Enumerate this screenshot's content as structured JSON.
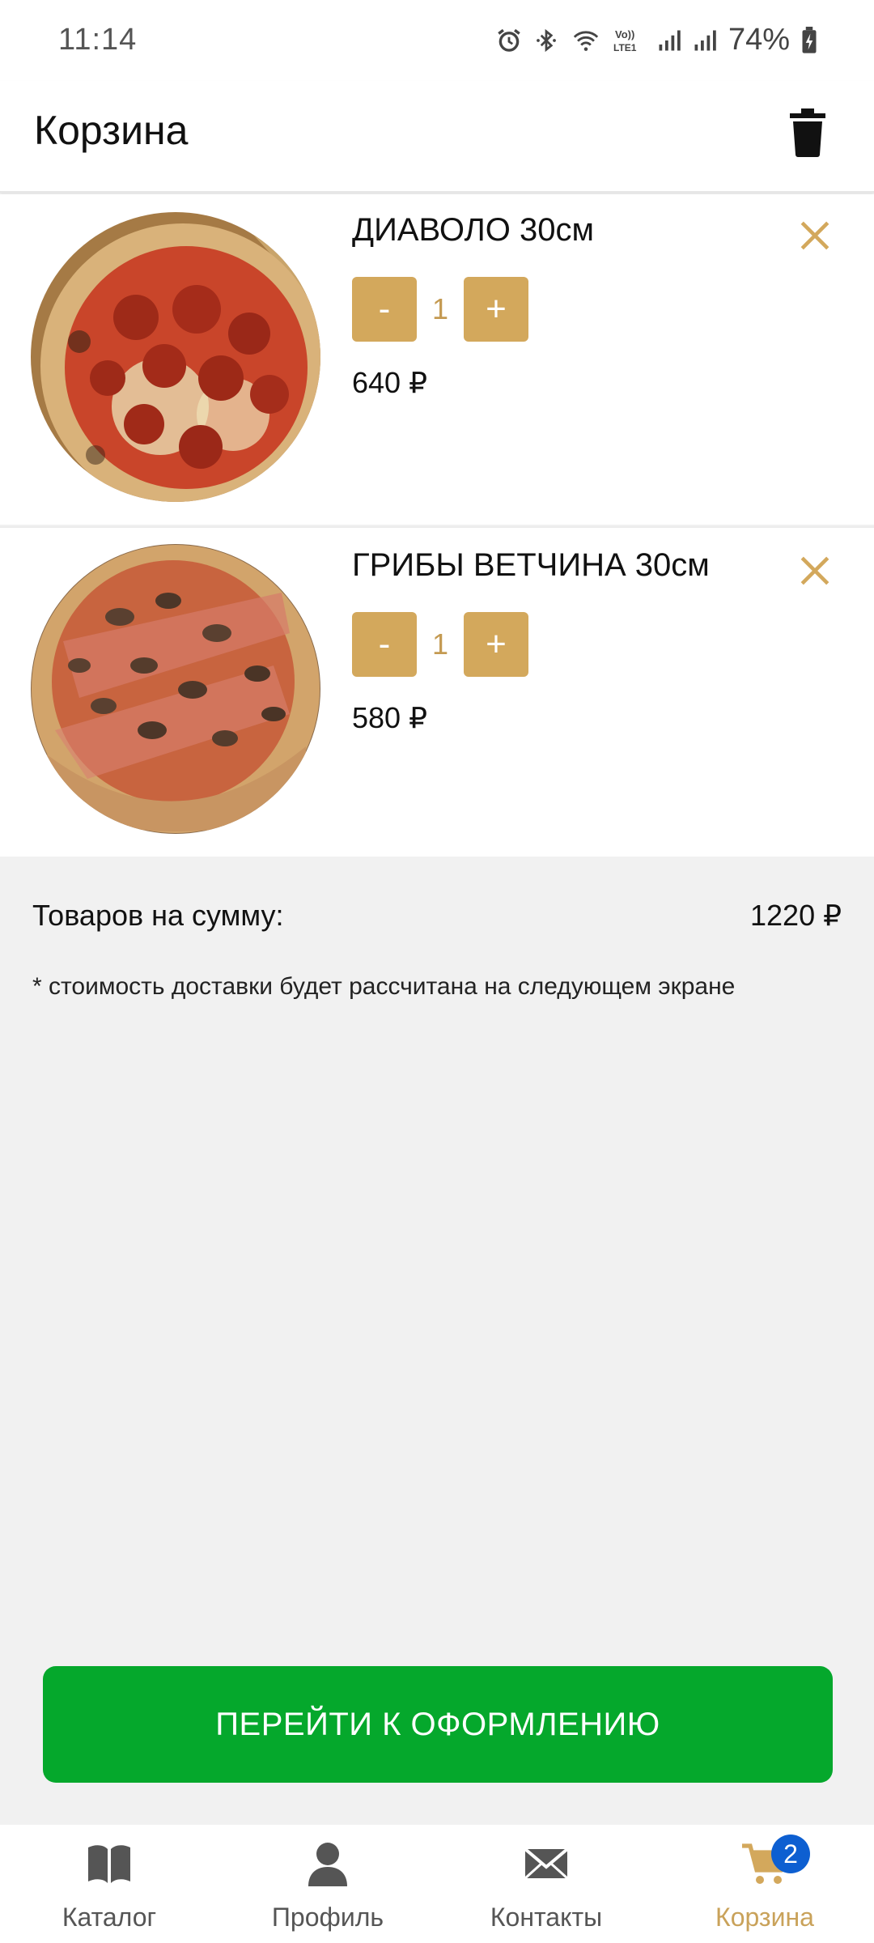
{
  "status_bar": {
    "time": "11:14",
    "battery": "74%",
    "icons": [
      "alarm-icon",
      "bluetooth-icon",
      "wifi-icon",
      "volte-icon",
      "signal-icon",
      "signal-icon",
      "battery-charging-icon"
    ]
  },
  "header": {
    "title": "Корзина",
    "clear_icon": "trash-icon"
  },
  "cart": {
    "items": [
      {
        "name": "ДИАВОЛО 30см",
        "minus": "-",
        "qty": "1",
        "plus": "+",
        "price": "640 ₽"
      },
      {
        "name": "ГРИБЫ ВЕТЧИНА 30см",
        "minus": "-",
        "qty": "1",
        "plus": "+",
        "price": "580 ₽"
      }
    ]
  },
  "summary": {
    "label": "Товаров на сумму:",
    "value": "1220 ₽",
    "note": "* стоимость доставки будет рассчитана на следующем экране"
  },
  "checkout": {
    "label": "ПЕРЕЙТИ К ОФОРМЛЕНИЮ"
  },
  "nav": {
    "items": [
      {
        "label": "Каталог",
        "icon": "book-icon"
      },
      {
        "label": "Профиль",
        "icon": "person-icon"
      },
      {
        "label": "Контакты",
        "icon": "envelope-icon"
      },
      {
        "label": "Корзина",
        "icon": "cart-icon",
        "badge": "2"
      }
    ]
  },
  "colors": {
    "accent": "#d3a85c",
    "checkout_green": "#05a82c",
    "badge_blue": "#0d5fd1",
    "background": "#f1f1f1"
  }
}
